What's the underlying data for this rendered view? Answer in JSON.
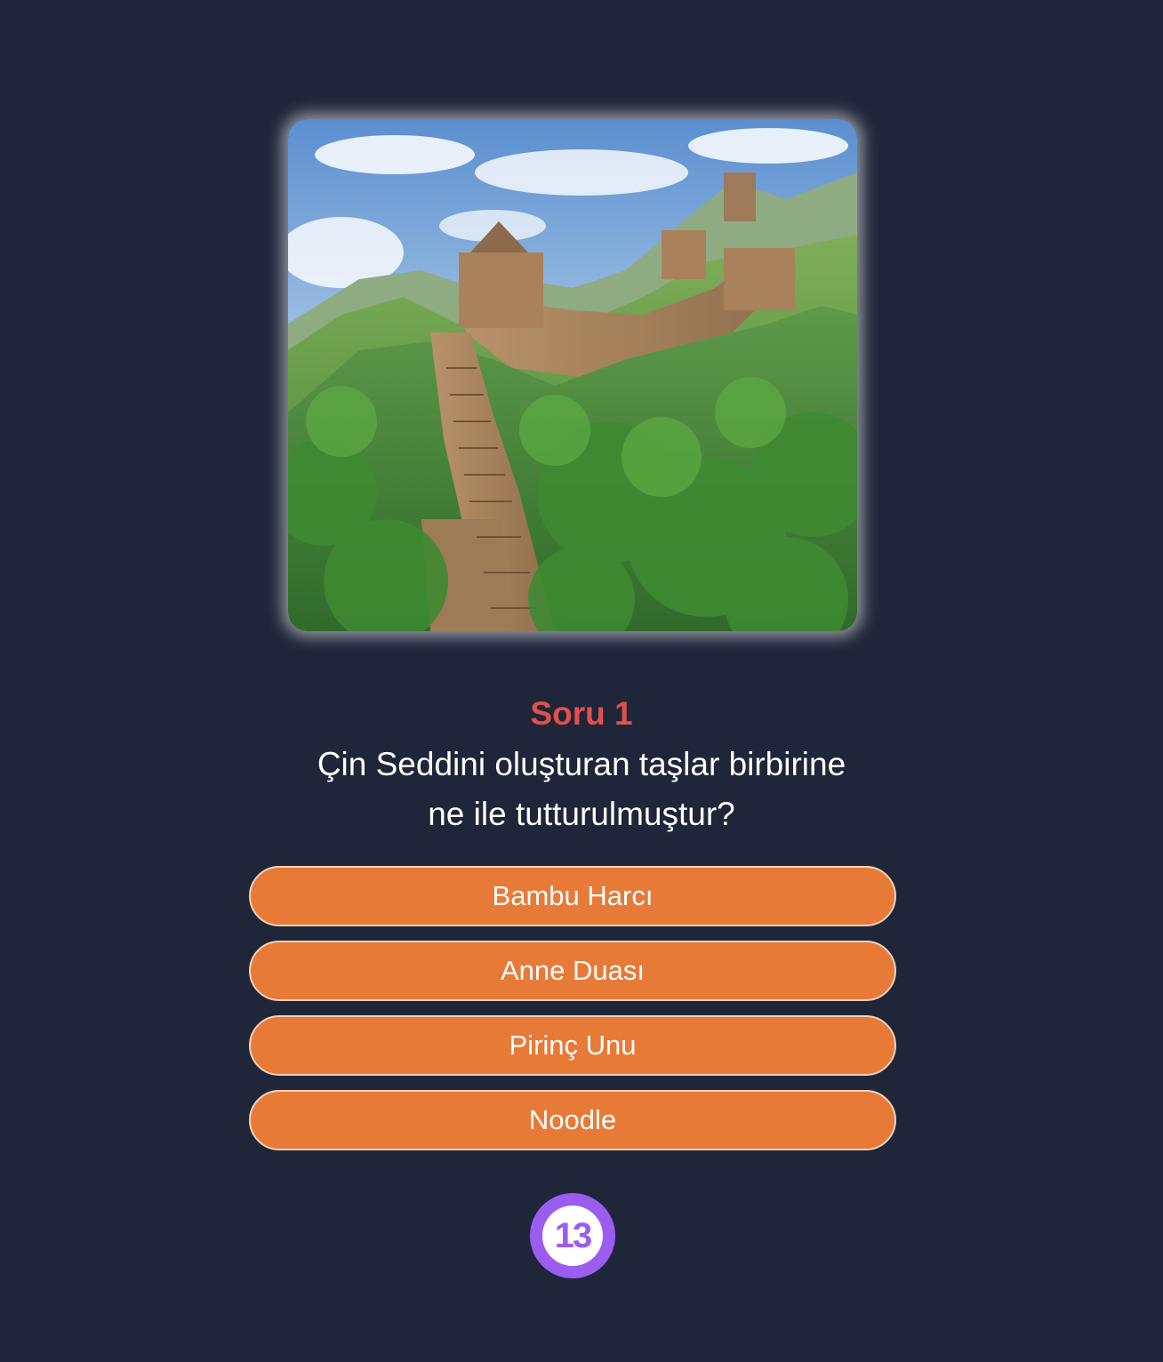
{
  "quiz": {
    "image_subject": "Great Wall of China",
    "question_number": "Soru 1",
    "question_text": "Çin Seddini oluşturan taşlar birbirine ne ile tutturulmuştur?",
    "answers": [
      {
        "label": "Bambu Harcı"
      },
      {
        "label": "Anne Duası"
      },
      {
        "label": "Pirinç Unu"
      },
      {
        "label": "Noodle"
      }
    ],
    "timer": "13"
  },
  "colors": {
    "background": "#1f263a",
    "question_number": "#e0514d",
    "answer_button": "#e87a38",
    "timer": "#9b5cf0"
  }
}
